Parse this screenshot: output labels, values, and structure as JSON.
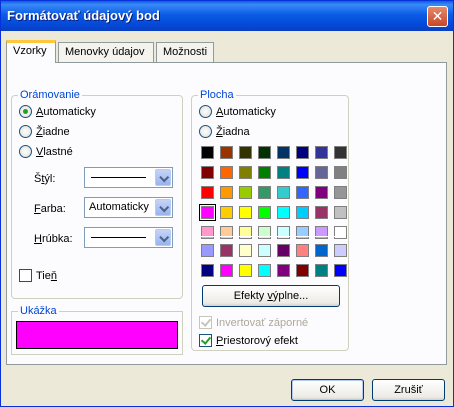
{
  "window": {
    "title": "Formátovať údajový bod",
    "close_glyph": "✕"
  },
  "tabs": [
    {
      "label": "Vzorky",
      "active": true
    },
    {
      "label": "Menovky údajov",
      "active": false
    },
    {
      "label": "Možnosti",
      "active": false
    }
  ],
  "border_group": {
    "title": "Orámovanie",
    "options": [
      {
        "key": "A",
        "rest": "utomaticky",
        "checked": true
      },
      {
        "key": "Ž",
        "rest": "iadne",
        "checked": false
      },
      {
        "key": "V",
        "rest": "lastné",
        "checked": false
      }
    ],
    "style": {
      "pre": "Š",
      "key": "t",
      "post": "ýl:"
    },
    "color": {
      "pre": "",
      "key": "F",
      "post": "arba:",
      "value": "Automaticky"
    },
    "weight": {
      "pre": "",
      "key": "H",
      "post": "rúbka:"
    },
    "shadow": {
      "pre": "Tie",
      "key": "ň",
      "post": "",
      "checked": false
    }
  },
  "preview": {
    "title": "Ukážka",
    "fill_color": "#ff00ff"
  },
  "area_group": {
    "title": "Plocha",
    "options": [
      {
        "key": "A",
        "rest": "utomaticky",
        "checked": false
      },
      {
        "key": "Ž",
        "rest": "iadna",
        "checked": false
      }
    ],
    "palette_main": [
      "#000000",
      "#993300",
      "#333300",
      "#003300",
      "#003366",
      "#000080",
      "#333399",
      "#333333",
      "#800000",
      "#ff6600",
      "#808000",
      "#008000",
      "#008080",
      "#0000ff",
      "#666699",
      "#808080",
      "#ff0000",
      "#ff9900",
      "#99cc00",
      "#339966",
      "#33cccc",
      "#3366ff",
      "#800080",
      "#969696",
      "#ff00ff",
      "#ffcc00",
      "#ffff00",
      "#00ff00",
      "#00ffff",
      "#00ccff",
      "#993366",
      "#c0c0c0",
      "#ff99cc",
      "#ffcc99",
      "#ffff99",
      "#ccffcc",
      "#ccffff",
      "#99ccff",
      "#cc99ff",
      "#ffffff"
    ],
    "palette_chart": [
      "#9999ff",
      "#993366",
      "#ffffcc",
      "#ccffff",
      "#660066",
      "#ff8080",
      "#0066cc",
      "#ccccff",
      "#000080",
      "#ff00ff",
      "#ffff00",
      "#00ffff",
      "#800080",
      "#800000",
      "#008080",
      "#0000ff"
    ],
    "selected_index": 24,
    "fill_effects": {
      "pre": "Efekty ",
      "key": "v",
      "post": "ýplne..."
    },
    "invert": {
      "label": "Invertovať záporné",
      "checked": true,
      "disabled": true
    },
    "shadow3d": {
      "pre": "",
      "key": "P",
      "post": "riestorový efekt",
      "checked": true
    }
  },
  "buttons": {
    "ok": "OK",
    "cancel": "Zrušiť"
  }
}
